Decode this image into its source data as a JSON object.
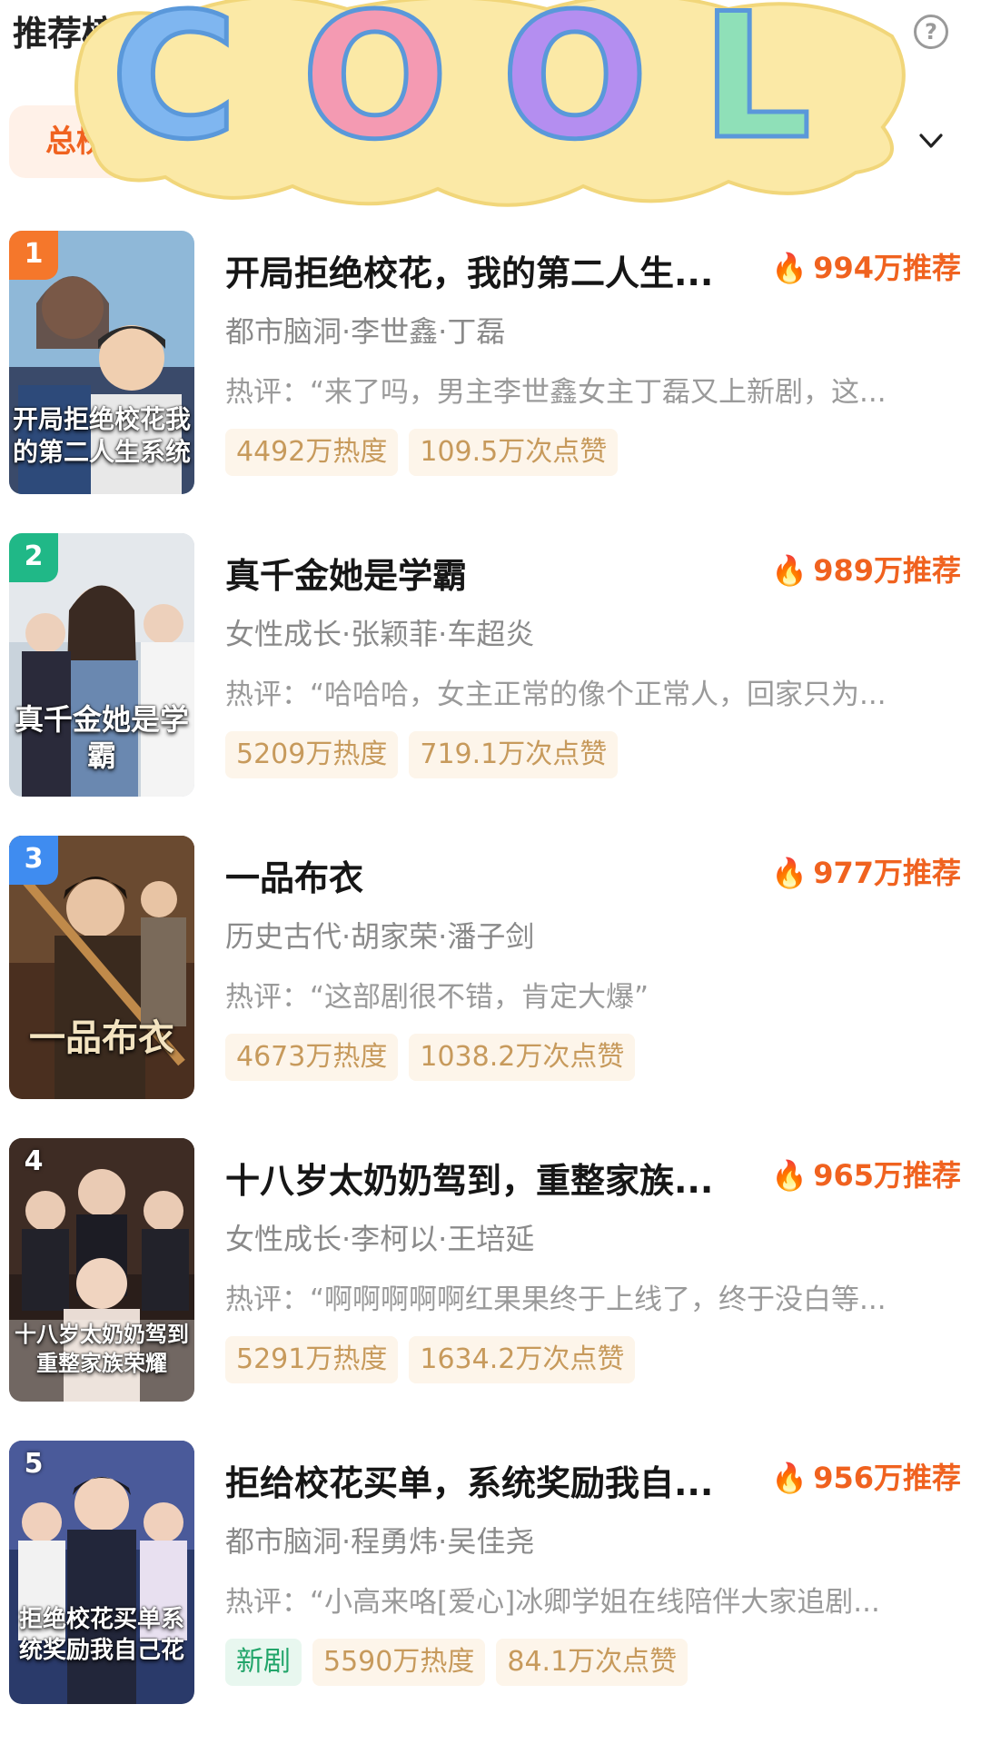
{
  "header": {
    "title": "推荐榜",
    "help_icon": "help-circle-icon"
  },
  "filter": {
    "active_tab": "总榜",
    "dropdown_icon": "chevron-down-icon"
  },
  "sticker": {
    "text": "COOL",
    "letter_colors": [
      "#7fb6f0",
      "#f49ab2",
      "#b48ef0",
      "#8fe0b8"
    ],
    "base_color": "#fbe9a6"
  },
  "accent": "#f0621f",
  "items": [
    {
      "rank": "1",
      "badge_color": "#f5772b",
      "cover_caption": "开局拒绝校花我的第二人生系统",
      "title": "开局拒绝校花，我的第二人生...",
      "recommend": "994万推荐",
      "meta": "都市脑洞·李世鑫·丁磊",
      "review": "热评：“来了吗，男主李世鑫女主丁磊又上新剧，这...",
      "tags": [
        "4492万热度",
        "109.5万次点赞"
      ]
    },
    {
      "rank": "2",
      "badge_color": "#20b887",
      "cover_caption": "真千金她是学霸",
      "title": "真千金她是学霸",
      "recommend": "989万推荐",
      "meta": "女性成长·张颖菲·车超炎",
      "review": "热评：“哈哈哈，女主正常的像个正常人，回家只为...",
      "tags": [
        "5209万热度",
        "719.1万次点赞"
      ]
    },
    {
      "rank": "3",
      "badge_color": "#3f8cf0",
      "cover_caption": "一品布衣",
      "title": "一品布衣",
      "recommend": "977万推荐",
      "meta": "历史古代·胡家荣·潘子剑",
      "review": "热评：“这部剧很不错，肯定大爆”",
      "tags": [
        "4673万热度",
        "1038.2万次点赞"
      ]
    },
    {
      "rank": "4",
      "badge_color": "",
      "cover_caption": "十八岁太奶奶驾到重整家族荣耀",
      "title": "十八岁太奶奶驾到，重整家族...",
      "recommend": "965万推荐",
      "meta": "女性成长·李柯以·王培延",
      "review": "热评：“啊啊啊啊啊红果果终于上线了，终于没白等...",
      "tags": [
        "5291万热度",
        "1634.2万次点赞"
      ]
    },
    {
      "rank": "5",
      "badge_color": "",
      "cover_caption": "拒绝校花买单系统奖励我自己花",
      "title": "拒给校花买单，系统奖励我自...",
      "recommend": "956万推荐",
      "meta": "都市脑洞·程勇炜·吴佳尧",
      "review": "热评：“小高来咯[爱心]冰卿学姐在线陪伴大家追剧...",
      "new_tag": "新剧",
      "tags": [
        "5590万热度",
        "84.1万次点赞"
      ]
    }
  ]
}
